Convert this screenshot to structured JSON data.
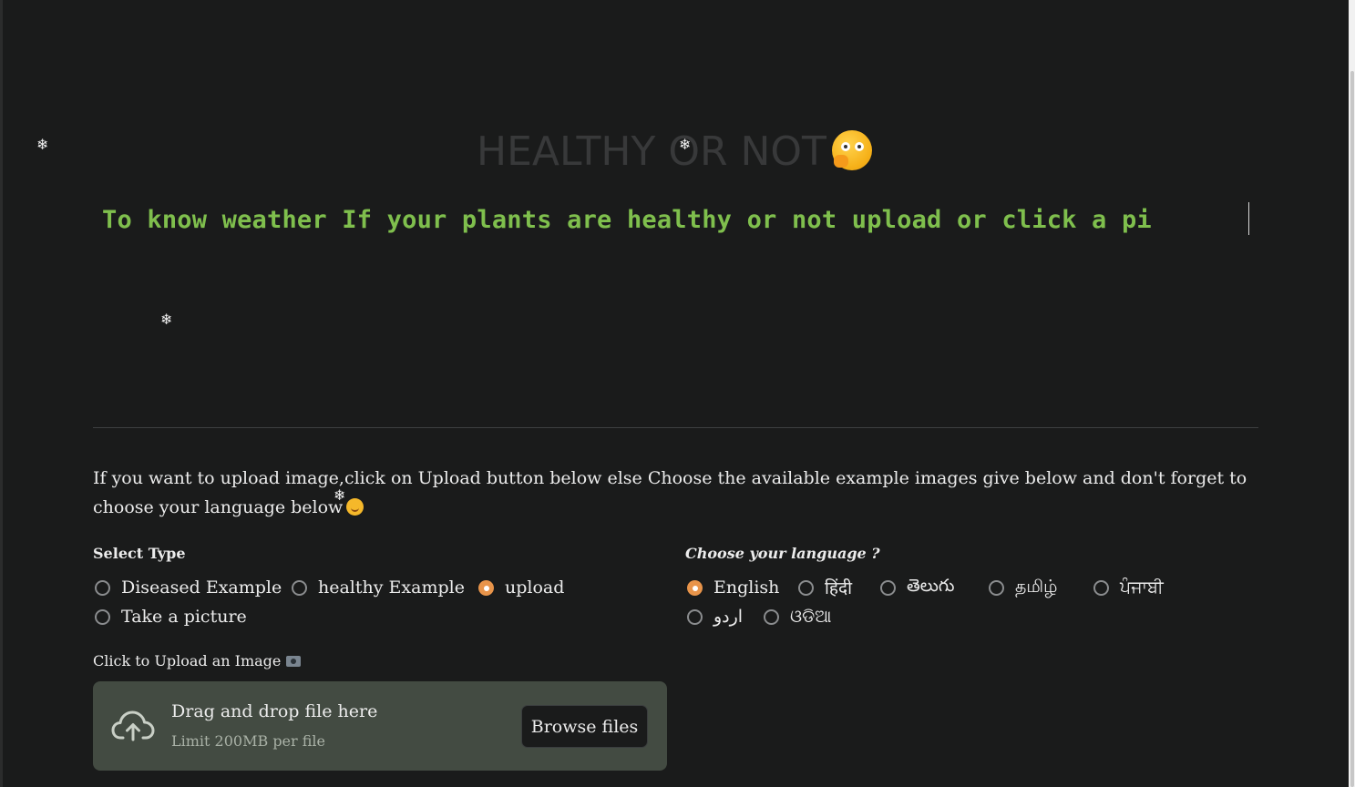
{
  "title": {
    "text": "HEALTHY OR NOT",
    "emoji": "thinking-face-emoji"
  },
  "marquee": {
    "text": "To know weather If your plants are healthy or not upload or click a pi"
  },
  "intro": {
    "text": "If you want to upload image,click on Upload button below else Choose the available example images give below and don't forget to choose your language below",
    "emoji": "smiling-face-emoji"
  },
  "select_type": {
    "label": "Select Type",
    "options": [
      "Diseased Example",
      "healthy Example",
      "upload",
      "Take a picture"
    ],
    "selected": "upload"
  },
  "language": {
    "label": "Choose your language ?",
    "options": [
      "English",
      "हिंदी",
      "తెలుగు",
      "தமிழ்",
      "ਪੰਜਾਬੀ",
      "اردو",
      "ଓଡିଆ"
    ],
    "selected": "English"
  },
  "uploader": {
    "label": "Click to Upload an Image",
    "label_icon": "camera-icon",
    "drop_text": "Drag and drop file here",
    "limit_text": "Limit 200MB per file",
    "browse_label": "Browse files",
    "icon": "cloud-upload-icon"
  },
  "colors": {
    "background": "#1a1b1b",
    "marquee_text": "#7fbf4d",
    "accent_radio": "#e8944a",
    "dropzone_bg": "#434b42"
  },
  "decorations": {
    "snowflake": "❄"
  }
}
